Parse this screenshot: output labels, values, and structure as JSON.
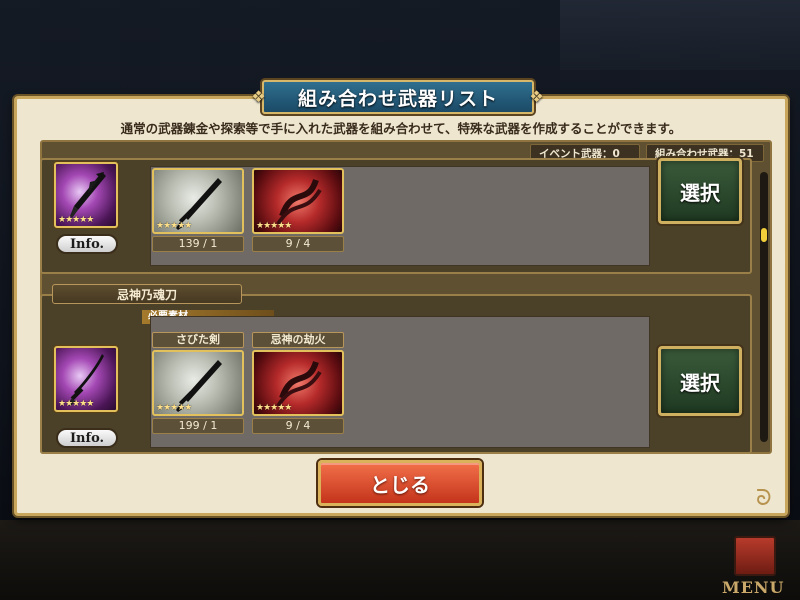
{
  "dialog": {
    "title": "組み合わせ武器リスト",
    "description": "通常の武器錬金や探索等で手に入れた武器を組み合わせて、特殊な武器を作成することができます。"
  },
  "stats": {
    "event_weapons": "イベント武器：0",
    "combo_weapons": "組み合わせ武器：51"
  },
  "rows": [
    {
      "name": "",
      "weapon_stars": "★★★★★",
      "info_label": "Info.",
      "materials": [
        {
          "name": "",
          "count": "139 / 1",
          "stars": "★★★★★",
          "style": "silver"
        },
        {
          "name": "",
          "count": "9 / 4",
          "stars": "★★★★★",
          "style": "red"
        }
      ],
      "select_label": "選択"
    },
    {
      "name": "忌神乃魂刀",
      "required_label": "必要素材",
      "weapon_stars": "★★★★★",
      "info_label": "Info.",
      "materials": [
        {
          "name": "さびた剣",
          "count": "199 / 1",
          "stars": "★★★★★",
          "style": "silver"
        },
        {
          "name": "忌神の劫火",
          "count": "9 / 4",
          "stars": "★★★★★",
          "style": "red"
        }
      ],
      "select_label": "選択"
    }
  ],
  "close_label": "とじる",
  "menu_label": "MENU",
  "colors": {
    "panel_bg": "#eee6cf",
    "title_bg": "#1b4a66",
    "gold_border": "#c8a75c",
    "close_button": "#c4341b",
    "select_button": "#1f3a22",
    "scroll_thumb": "#f2cf3a"
  }
}
